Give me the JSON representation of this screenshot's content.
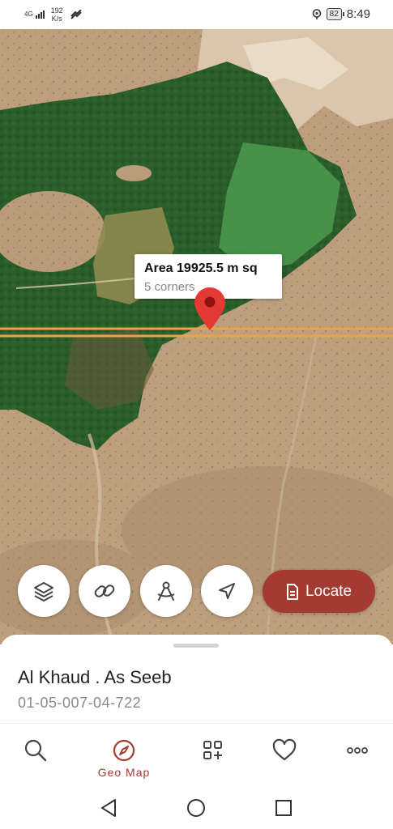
{
  "status_bar": {
    "network": "4G",
    "speed_value": "192",
    "speed_unit": "K/s",
    "battery": "82",
    "time": "8:49"
  },
  "map": {
    "callout": {
      "area": "Area 19925.5 m sq",
      "corners": "5 corners"
    }
  },
  "actions": {
    "locate_label": "Locate"
  },
  "sheet": {
    "place_name": "Al Khaud . As Seeb",
    "place_code": "01-05-007-04-722"
  },
  "bottom_nav": {
    "items": [
      {
        "icon": "search-icon",
        "label": ""
      },
      {
        "icon": "compass-icon",
        "label": "Geo Map"
      },
      {
        "icon": "grid-add-icon",
        "label": ""
      },
      {
        "icon": "heart-icon",
        "label": ""
      },
      {
        "icon": "more-icon",
        "label": ""
      }
    ]
  },
  "colors": {
    "accent": "#a53a33",
    "line": "#f0a046",
    "pin": "#e53935"
  }
}
